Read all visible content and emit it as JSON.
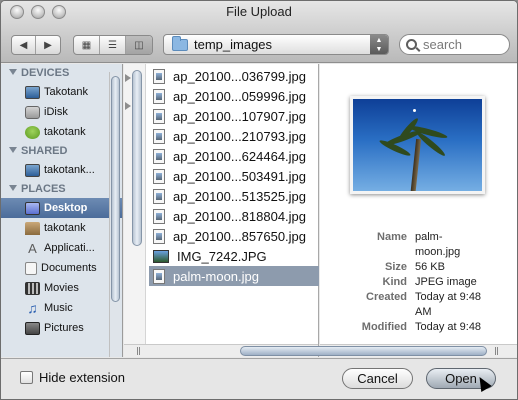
{
  "window": {
    "title": "File Upload"
  },
  "toolbar": {
    "nav_back_icon": "chevron-left-icon",
    "nav_forward_icon": "chevron-right-icon",
    "views": [
      "icon-view-icon",
      "list-view-icon",
      "column-view-icon"
    ],
    "path": "temp_images",
    "search_placeholder": "search"
  },
  "sidebar": {
    "sections": [
      {
        "title": "DEVICES",
        "items": [
          {
            "label": "Takotank",
            "icon": "computer-icon"
          },
          {
            "label": "iDisk",
            "icon": "idisk-icon"
          },
          {
            "label": "takotank",
            "icon": "alien-icon"
          }
        ]
      },
      {
        "title": "SHARED",
        "items": [
          {
            "label": "takotank...",
            "icon": "network-computer-icon"
          }
        ]
      },
      {
        "title": "PLACES",
        "items": [
          {
            "label": "Desktop",
            "icon": "desktop-icon",
            "selected": true
          },
          {
            "label": "takotank",
            "icon": "home-icon"
          },
          {
            "label": "Applicati...",
            "icon": "applications-icon"
          },
          {
            "label": "Documents",
            "icon": "documents-icon"
          },
          {
            "label": "Movies",
            "icon": "movies-icon"
          },
          {
            "label": "Music",
            "icon": "music-icon"
          },
          {
            "label": "Pictures",
            "icon": "pictures-icon"
          }
        ]
      }
    ]
  },
  "files": [
    {
      "name": "ap_20100...036799.jpg",
      "icon": "jpeg-file-icon"
    },
    {
      "name": "ap_20100...059996.jpg",
      "icon": "jpeg-file-icon"
    },
    {
      "name": "ap_20100...107907.jpg",
      "icon": "jpeg-file-icon"
    },
    {
      "name": "ap_20100...210793.jpg",
      "icon": "jpeg-file-icon"
    },
    {
      "name": "ap_20100...624464.jpg",
      "icon": "jpeg-file-icon"
    },
    {
      "name": "ap_20100...503491.jpg",
      "icon": "jpeg-file-icon"
    },
    {
      "name": "ap_20100...513525.jpg",
      "icon": "jpeg-file-icon"
    },
    {
      "name": "ap_20100...818804.jpg",
      "icon": "jpeg-file-icon"
    },
    {
      "name": "ap_20100...857650.jpg",
      "icon": "jpeg-file-icon"
    },
    {
      "name": "IMG_7242.JPG",
      "icon": "image-thumbnail-icon"
    },
    {
      "name": "palm-moon.jpg",
      "icon": "jpeg-file-icon",
      "selected": true
    }
  ],
  "preview": {
    "image_icon": "palm-tree-photo",
    "meta": [
      {
        "key": "Name",
        "value": "palm-\nmoon.jpg"
      },
      {
        "key": "Size",
        "value": "56 KB"
      },
      {
        "key": "Kind",
        "value": "JPEG image"
      },
      {
        "key": "Created",
        "value": "Today at 9:48\nAM"
      },
      {
        "key": "Modified",
        "value": "Today at 9:48"
      }
    ]
  },
  "footer": {
    "hide_extension_label": "Hide extension",
    "hide_extension_checked": false,
    "cancel_label": "Cancel",
    "open_label": "Open"
  }
}
